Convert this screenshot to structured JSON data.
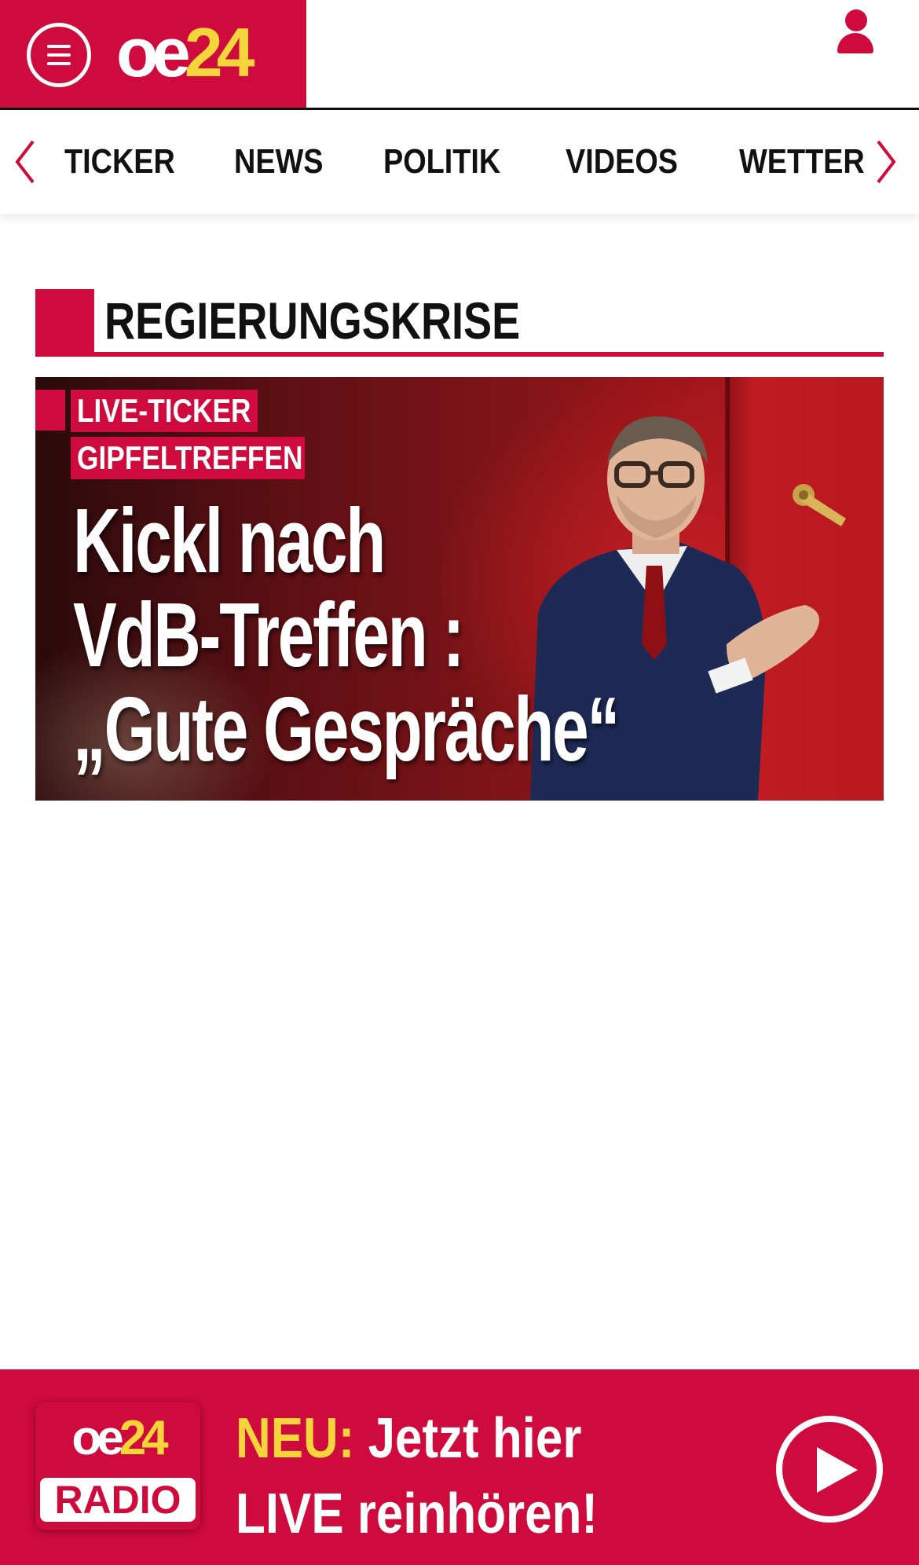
{
  "header": {
    "logo_oe": "oe",
    "logo_num": "24",
    "menu_icon": "hamburger-menu-icon",
    "user_icon": "user-icon"
  },
  "nav": {
    "left_arrow_icon": "chevron-left-icon",
    "right_arrow_icon": "chevron-right-icon",
    "items": [
      "TICKER",
      "NEWS",
      "POLITIK",
      "VIDEOS",
      "WETTER"
    ]
  },
  "section": {
    "title": "REGIERUNGSKRISE"
  },
  "hero": {
    "badge_1": "LIVE-TICKER",
    "badge_2": "GIPFELTREFFEN",
    "headline_lines": [
      "Kickl nach",
      "VdB-Treffen :",
      "„Gute Gespräche“"
    ]
  },
  "radio": {
    "logo_oe": "oe",
    "logo_num": "24",
    "logo_label": "RADIO",
    "neu": "NEU:",
    "line1_rest": "Jetzt hier",
    "line2": "LIVE reinhören!",
    "play_icon": "play-icon"
  },
  "colors": {
    "brand_red": "#cf0a3d",
    "logo_yellow": "#f5d53b",
    "text_dark": "#111111"
  }
}
